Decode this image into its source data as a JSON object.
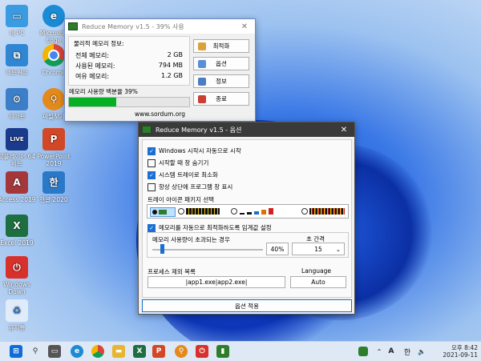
{
  "desktop": {
    "icons": [
      {
        "label": "내 PC"
      },
      {
        "label": "Microsoft Edge"
      },
      {
        "label": "네트워크"
      },
      {
        "label": "Chrome"
      },
      {
        "label": "제어판"
      },
      {
        "label": "파일찾기"
      },
      {
        "label": "팟플레이어 64 비트"
      },
      {
        "label": "PowerPoint 2019"
      },
      {
        "label": "Access 2019"
      },
      {
        "label": "한글 2020"
      },
      {
        "label": "Excel 2019"
      },
      {
        "label": "Windows Down"
      },
      {
        "label": "휴지통"
      }
    ]
  },
  "main_window": {
    "title": "Reduce Memory v1.5 - 39% 사용",
    "group_title": "물리적 메모리 정보:",
    "rows": [
      {
        "label": "전체 메모리:",
        "value": "2 GB"
      },
      {
        "label": "사용된 메모리:",
        "value": "794 MB"
      },
      {
        "label": "여유 메모리:",
        "value": "1.2 GB"
      }
    ],
    "usage_label": "메모리 사용량 백분율 39%",
    "usage_percent": 39,
    "buttons": {
      "optimize": "최적화",
      "options": "옵션",
      "info": "정보",
      "exit": "종료"
    },
    "footer": "www.sordum.org"
  },
  "options_window": {
    "title": "Reduce Memory v1.5 - 옵션",
    "checkboxes": [
      {
        "label": "Windows 시작시 자동으로 시작",
        "checked": true
      },
      {
        "label": "시작할 때 창 숨기기",
        "checked": false
      },
      {
        "label": "시스템 트레이로 최소화",
        "checked": true
      },
      {
        "label": "항상 상단에 프로그램 창 표시",
        "checked": false
      }
    ],
    "tray_label": "트레이 아이콘 패키지 선택",
    "auto_optimize_label": "메모리를 자동으로 최적화하도록 임계값 설정",
    "auto_optimize_checked": true,
    "threshold_label": "메모리 사용량이 초과되는 경우",
    "threshold_value": "40%",
    "threshold_percent": 40,
    "interval_label": "초 간격",
    "interval_value": "15",
    "exclude_label": "프로세스 제외 목록",
    "exclude_value": "|app1.exe|app2.exe|",
    "language_label": "Language",
    "language_value": "Auto",
    "apply_button": "옵션 적용"
  },
  "taskbar": {
    "tray_letter": "A",
    "ime": "한",
    "time": "오후 8:42",
    "date": "2021-09-11"
  }
}
